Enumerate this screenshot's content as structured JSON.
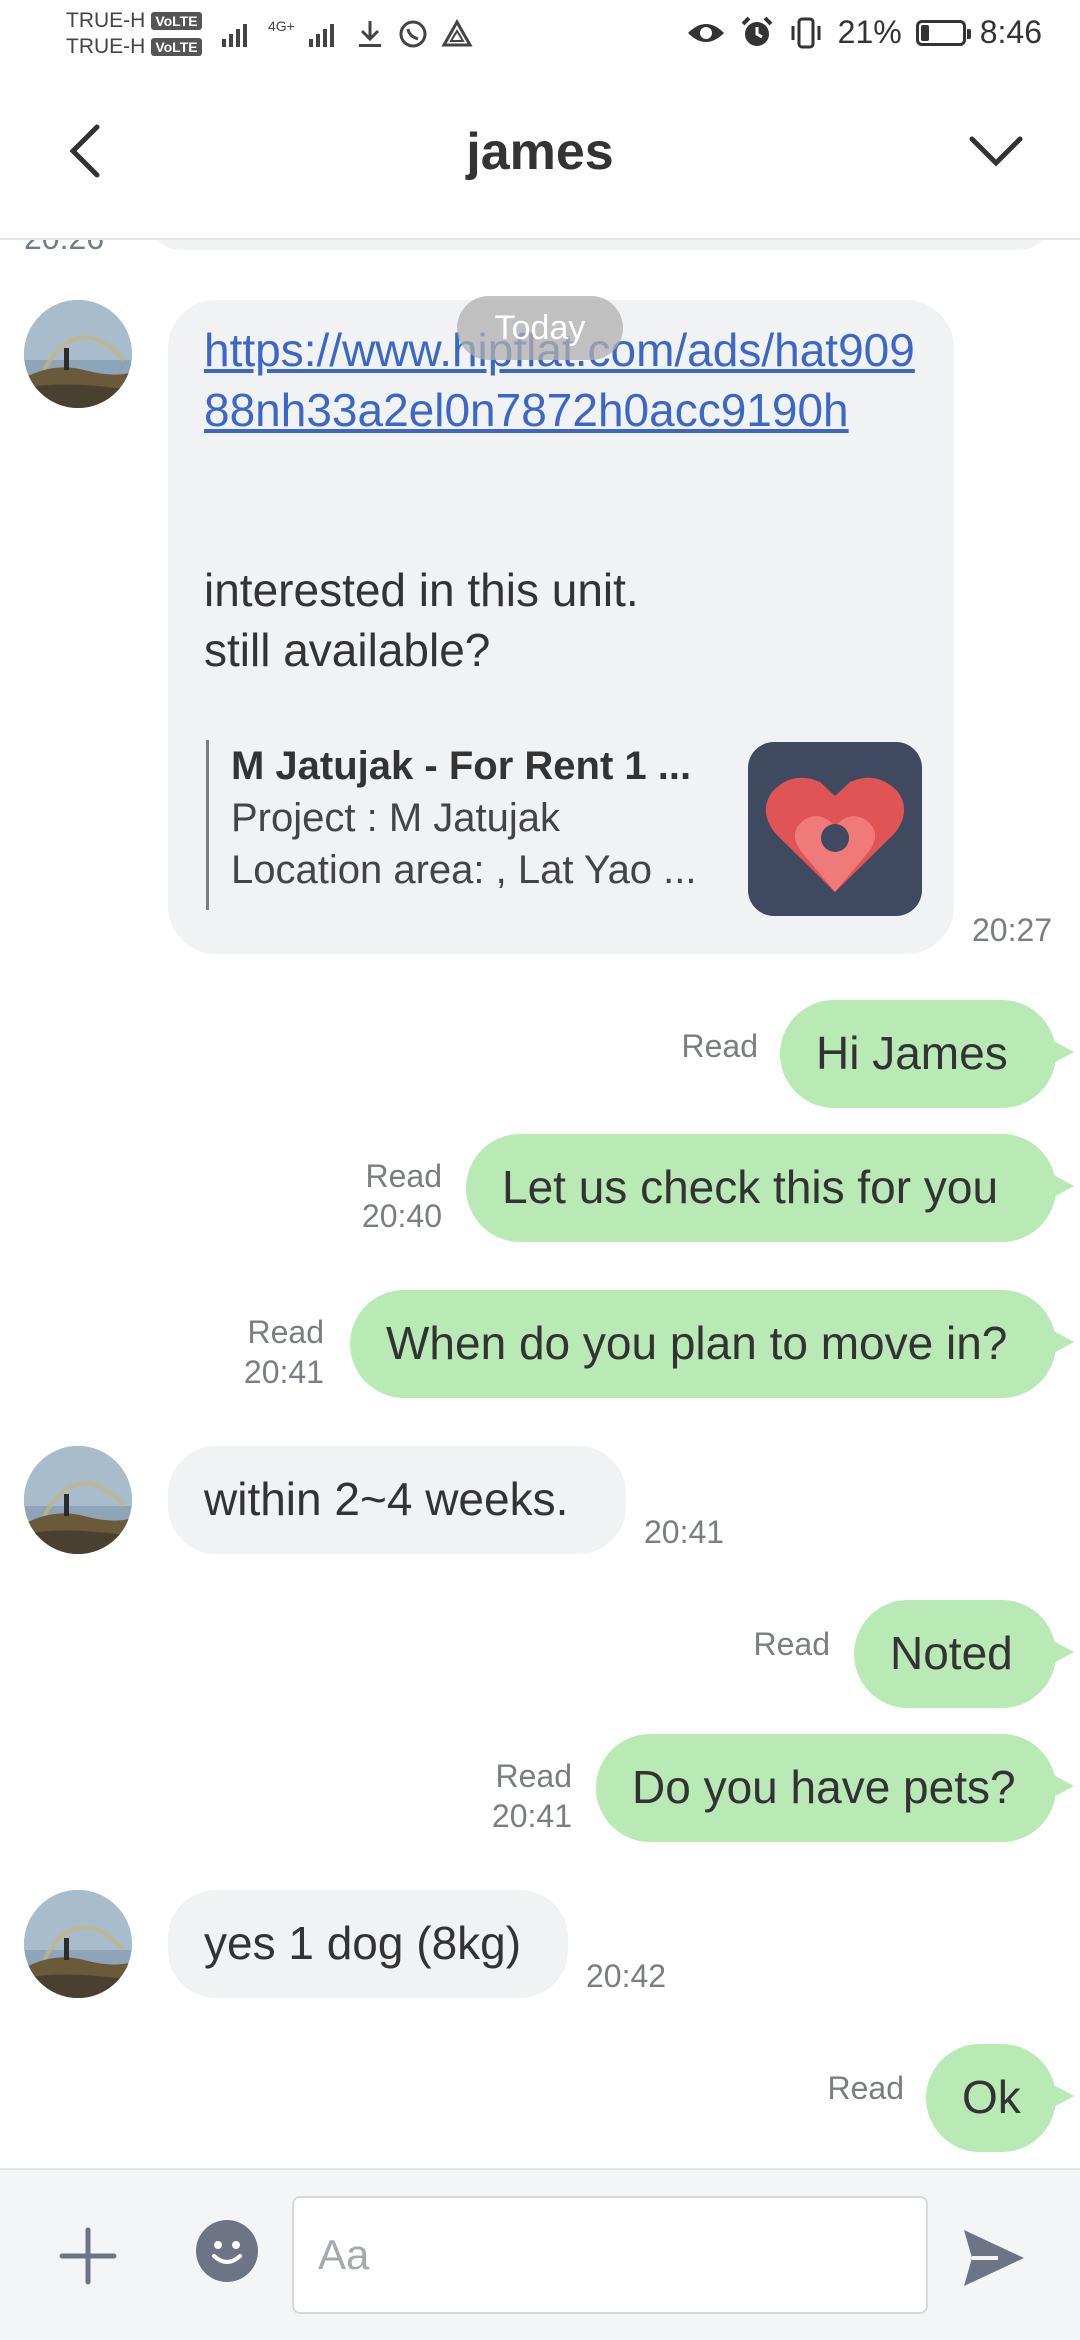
{
  "status_bar": {
    "carrier1": "TRUE-H",
    "carrier2": "TRUE-H",
    "volte_badge": "VoLTE",
    "network": "4G+",
    "battery_percent": "21%",
    "battery_level": 0.21,
    "time": "8:46"
  },
  "header": {
    "title": "james"
  },
  "chat": {
    "partial_time": "20:26",
    "date_divider": "Today",
    "messages": [
      {
        "link": "https://www.hipflat.com/ads/hat90988nh33a2el0n7872h0acc9190h",
        "text_line1": "interested in this unit.",
        "text_line2": "still available?",
        "card_title": "M Jatujak - For Rent 1 ...",
        "card_line1": "Project : M Jatujak",
        "card_line2": "Location area: , Lat Yao ...",
        "time": "20:27"
      },
      {
        "text": "Hi James",
        "status": "Read"
      },
      {
        "text": "Let us check this for you",
        "status": "Read",
        "time": "20:40"
      },
      {
        "text": "When do you plan to move in?",
        "status": "Read",
        "time": "20:41"
      },
      {
        "text": "within 2~4 weeks.",
        "time": "20:41"
      },
      {
        "text": "Noted",
        "status": "Read"
      },
      {
        "text": "Do you have pets?",
        "status": "Read",
        "time": "20:41"
      },
      {
        "text": "yes 1 dog (8kg)",
        "time": "20:42"
      },
      {
        "text": "Ok",
        "status": "Read"
      }
    ]
  },
  "input": {
    "placeholder": "Aa",
    "value": ""
  },
  "colors": {
    "outgoing_bubble": "#b9e9b4",
    "incoming_bubble": "#f1f2f4",
    "link": "#3c67c8"
  }
}
